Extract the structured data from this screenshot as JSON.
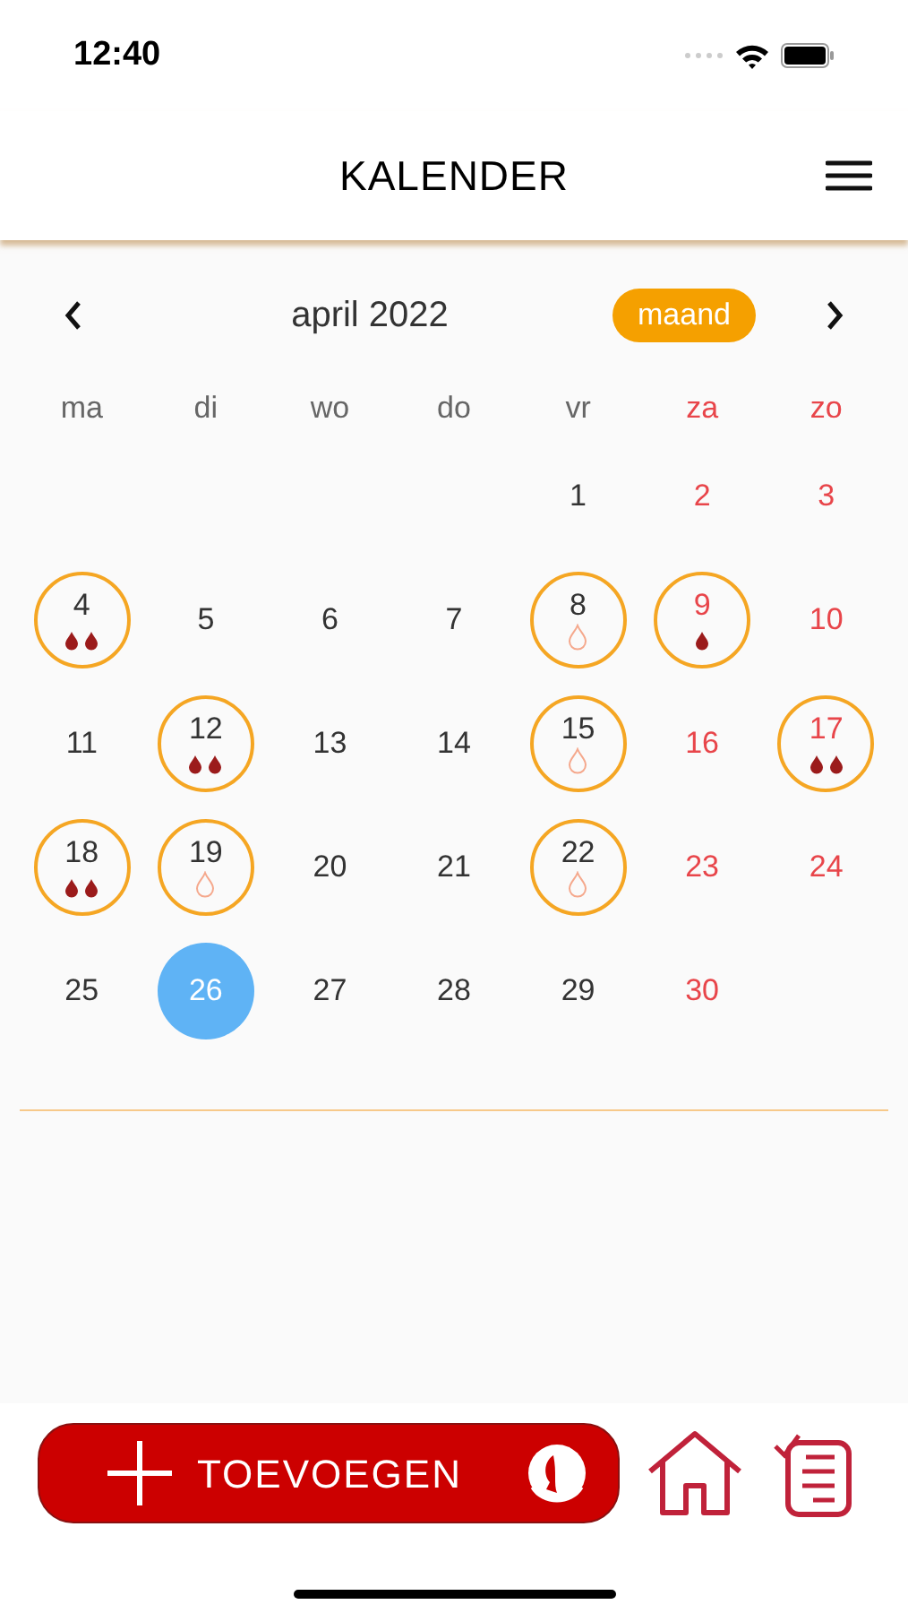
{
  "status_bar": {
    "time": "12:40"
  },
  "header": {
    "title": "KALENDER"
  },
  "calendar": {
    "month": "april 2022",
    "view_button": "maand",
    "weekdays": [
      {
        "label": "ma",
        "weekend": false
      },
      {
        "label": "di",
        "weekend": false
      },
      {
        "label": "wo",
        "weekend": false
      },
      {
        "label": "do",
        "weekend": false
      },
      {
        "label": "vr",
        "weekend": false
      },
      {
        "label": "za",
        "weekend": true
      },
      {
        "label": "zo",
        "weekend": true
      }
    ],
    "weeks": [
      [
        {
          "kind": "empty"
        },
        {
          "kind": "empty"
        },
        {
          "kind": "empty"
        },
        {
          "kind": "empty"
        },
        {
          "kind": "day",
          "day": "1",
          "weekend": false,
          "marked": false,
          "selected": false
        },
        {
          "kind": "day",
          "day": "2",
          "weekend": true,
          "marked": false,
          "selected": false
        },
        {
          "kind": "day",
          "day": "3",
          "weekend": true,
          "marked": false,
          "selected": false
        }
      ],
      [
        {
          "kind": "day",
          "day": "4",
          "weekend": false,
          "marked": true,
          "selected": false,
          "drops": [
            {
              "kind": "filled"
            },
            {
              "kind": "filled"
            }
          ]
        },
        {
          "kind": "day",
          "day": "5",
          "weekend": false,
          "marked": false,
          "selected": false
        },
        {
          "kind": "day",
          "day": "6",
          "weekend": false,
          "marked": false,
          "selected": false
        },
        {
          "kind": "day",
          "day": "7",
          "weekend": false,
          "marked": false,
          "selected": false
        },
        {
          "kind": "day",
          "day": "8",
          "weekend": false,
          "marked": true,
          "selected": false,
          "drops": [
            {
              "kind": "outline"
            }
          ]
        },
        {
          "kind": "day",
          "day": "9",
          "weekend": true,
          "marked": true,
          "selected": false,
          "drops": [
            {
              "kind": "filled"
            }
          ]
        },
        {
          "kind": "day",
          "day": "10",
          "weekend": true,
          "marked": false,
          "selected": false
        }
      ],
      [
        {
          "kind": "day",
          "day": "11",
          "weekend": false,
          "marked": false,
          "selected": false
        },
        {
          "kind": "day",
          "day": "12",
          "weekend": false,
          "marked": true,
          "selected": false,
          "drops": [
            {
              "kind": "filled"
            },
            {
              "kind": "filled"
            }
          ]
        },
        {
          "kind": "day",
          "day": "13",
          "weekend": false,
          "marked": false,
          "selected": false
        },
        {
          "kind": "day",
          "day": "14",
          "weekend": false,
          "marked": false,
          "selected": false
        },
        {
          "kind": "day",
          "day": "15",
          "weekend": false,
          "marked": true,
          "selected": false,
          "drops": [
            {
              "kind": "outline"
            }
          ]
        },
        {
          "kind": "day",
          "day": "16",
          "weekend": true,
          "marked": false,
          "selected": false
        },
        {
          "kind": "day",
          "day": "17",
          "weekend": true,
          "marked": true,
          "selected": false,
          "drops": [
            {
              "kind": "filled"
            },
            {
              "kind": "filled"
            }
          ]
        }
      ],
      [
        {
          "kind": "day",
          "day": "18",
          "weekend": false,
          "marked": true,
          "selected": false,
          "drops": [
            {
              "kind": "filled"
            },
            {
              "kind": "filled"
            }
          ]
        },
        {
          "kind": "day",
          "day": "19",
          "weekend": false,
          "marked": true,
          "selected": false,
          "drops": [
            {
              "kind": "outline"
            }
          ]
        },
        {
          "kind": "day",
          "day": "20",
          "weekend": false,
          "marked": false,
          "selected": false
        },
        {
          "kind": "day",
          "day": "21",
          "weekend": false,
          "marked": false,
          "selected": false
        },
        {
          "kind": "day",
          "day": "22",
          "weekend": false,
          "marked": true,
          "selected": false,
          "drops": [
            {
              "kind": "outline"
            }
          ]
        },
        {
          "kind": "day",
          "day": "23",
          "weekend": true,
          "marked": false,
          "selected": false
        },
        {
          "kind": "day",
          "day": "24",
          "weekend": true,
          "marked": false,
          "selected": false
        }
      ],
      [
        {
          "kind": "day",
          "day": "25",
          "weekend": false,
          "marked": false,
          "selected": false
        },
        {
          "kind": "day",
          "day": "26",
          "marked": false,
          "selected": true
        },
        {
          "kind": "day",
          "day": "27",
          "weekend": false,
          "marked": false,
          "selected": false
        },
        {
          "kind": "day",
          "day": "28",
          "weekend": false,
          "marked": false,
          "selected": false
        },
        {
          "kind": "day",
          "day": "29",
          "weekend": false,
          "marked": false,
          "selected": false
        },
        {
          "kind": "day",
          "day": "30",
          "weekend": true,
          "marked": false,
          "selected": false
        },
        {
          "kind": "empty"
        }
      ]
    ]
  },
  "bottom_bar": {
    "add_button": "TOEVOEGEN"
  }
}
